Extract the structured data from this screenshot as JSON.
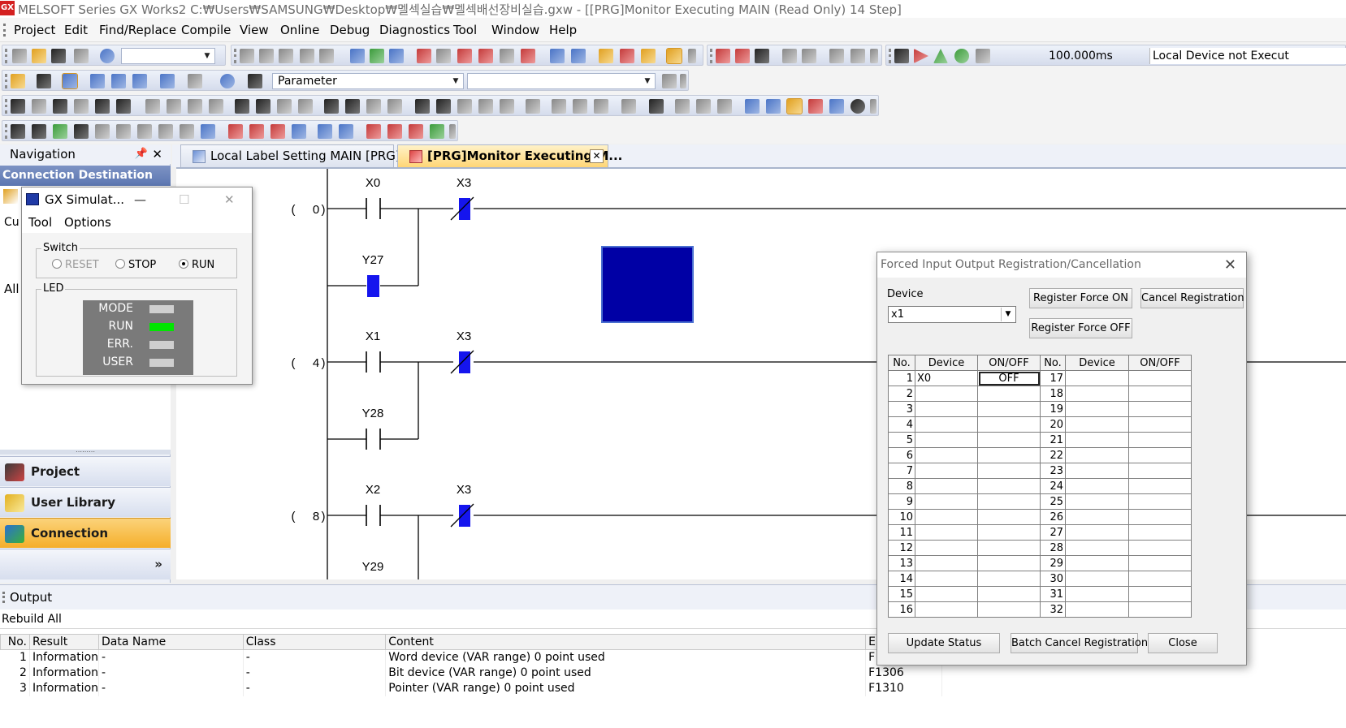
{
  "window": {
    "title": "MELSOFT Series GX Works2 C:₩Users₩SAMSUNG₩Desktop₩멜섹실습₩멜섹배선장비실습.gxw - [[PRG]Monitor Executing MAIN (Read Only) 14 Step]",
    "app_icon_text": "GX"
  },
  "menu": {
    "items": [
      {
        "label": "Project"
      },
      {
        "label": "Edit"
      },
      {
        "label": "Find/Replace"
      },
      {
        "label": "Compile"
      },
      {
        "label": "View"
      },
      {
        "label": "Online"
      },
      {
        "label": "Debug"
      },
      {
        "label": "Diagnostics"
      },
      {
        "label": "Tool"
      },
      {
        "label": "Window"
      },
      {
        "label": "Help"
      }
    ]
  },
  "toolbar": {
    "scan_time": "100.000ms",
    "device_status": "Local Device not Execut",
    "parameter_combo": "Parameter"
  },
  "navigation": {
    "title": "Navigation",
    "pin": "ᵖ",
    "close": "✕",
    "section": "Connection Destination",
    "fragment1": "Cu",
    "fragment2": "All",
    "buttons": [
      {
        "label": "Project"
      },
      {
        "label": "User Library"
      },
      {
        "label": "Connection Destination"
      }
    ],
    "more": "»"
  },
  "tabs": [
    {
      "label": "Local Label Setting MAIN [PRG]"
    },
    {
      "label": "[PRG]Monitor Executing M...",
      "close": "✕"
    }
  ],
  "ladder": {
    "rungs": [
      {
        "step": "0",
        "contact": "X0",
        "branch": "Y27",
        "coil": "X3"
      },
      {
        "step": "4",
        "contact": "X1",
        "branch": "Y28",
        "coil": "X3"
      },
      {
        "step": "8",
        "contact": "X2",
        "branch": "Y29",
        "coil": "X3"
      }
    ],
    "step_open": "(",
    "step_close": ")"
  },
  "simulator": {
    "title": "GX Simulat...",
    "min": "—",
    "max": "☐",
    "close": "✕",
    "menu": [
      "Tool",
      "Options"
    ],
    "switch_label": "Switch",
    "modes": [
      {
        "label": "RESET",
        "selected": false,
        "disabled": true
      },
      {
        "label": "STOP",
        "selected": false,
        "disabled": false
      },
      {
        "label": "RUN",
        "selected": true,
        "disabled": false
      }
    ],
    "led_label": "LED",
    "leds": [
      {
        "name": "MODE",
        "color": "#cfcfcf"
      },
      {
        "name": "RUN",
        "color": "#00e600"
      },
      {
        "name": "ERR.",
        "color": "#cfcfcf"
      },
      {
        "name": "USER",
        "color": "#cfcfcf"
      }
    ]
  },
  "forced_dialog": {
    "title": "Forced Input Output Registration/Cancellation",
    "close": "✕",
    "device_label": "Device",
    "device_value": "x1",
    "buttons": {
      "force_on": "Register Force ON",
      "force_off": "Register Force OFF",
      "cancel_reg": "Cancel Registration",
      "update": "Update Status",
      "batch_cancel": "Batch Cancel Registration",
      "close": "Close"
    },
    "columns": [
      "No.",
      "Device",
      "ON/OFF",
      "No.",
      "Device",
      "ON/OFF"
    ],
    "rows": [
      {
        "no": "1",
        "device": "X0",
        "state": "OFF",
        "no2": "17",
        "device2": "",
        "state2": ""
      },
      {
        "no": "2",
        "device": "",
        "state": "",
        "no2": "18",
        "device2": "",
        "state2": ""
      },
      {
        "no": "3",
        "device": "",
        "state": "",
        "no2": "19",
        "device2": "",
        "state2": ""
      },
      {
        "no": "4",
        "device": "",
        "state": "",
        "no2": "20",
        "device2": "",
        "state2": ""
      },
      {
        "no": "5",
        "device": "",
        "state": "",
        "no2": "21",
        "device2": "",
        "state2": ""
      },
      {
        "no": "6",
        "device": "",
        "state": "",
        "no2": "22",
        "device2": "",
        "state2": ""
      },
      {
        "no": "7",
        "device": "",
        "state": "",
        "no2": "23",
        "device2": "",
        "state2": ""
      },
      {
        "no": "8",
        "device": "",
        "state": "",
        "no2": "24",
        "device2": "",
        "state2": ""
      },
      {
        "no": "9",
        "device": "",
        "state": "",
        "no2": "25",
        "device2": "",
        "state2": ""
      },
      {
        "no": "10",
        "device": "",
        "state": "",
        "no2": "26",
        "device2": "",
        "state2": ""
      },
      {
        "no": "11",
        "device": "",
        "state": "",
        "no2": "27",
        "device2": "",
        "state2": ""
      },
      {
        "no": "12",
        "device": "",
        "state": "",
        "no2": "28",
        "device2": "",
        "state2": ""
      },
      {
        "no": "13",
        "device": "",
        "state": "",
        "no2": "29",
        "device2": "",
        "state2": ""
      },
      {
        "no": "14",
        "device": "",
        "state": "",
        "no2": "30",
        "device2": "",
        "state2": ""
      },
      {
        "no": "15",
        "device": "",
        "state": "",
        "no2": "31",
        "device2": "",
        "state2": ""
      },
      {
        "no": "16",
        "device": "",
        "state": "",
        "no2": "32",
        "device2": "",
        "state2": ""
      }
    ]
  },
  "output": {
    "title": "Output",
    "subtitle": "Rebuild All",
    "columns": [
      "No.",
      "Result",
      "Data Name",
      "Class",
      "Content",
      "Er"
    ],
    "rows": [
      {
        "no": "1",
        "result": "Information",
        "data_name": "-",
        "class": "-",
        "content": "Word device (VAR range) 0 point used",
        "code": "F"
      },
      {
        "no": "2",
        "result": "Information",
        "data_name": "-",
        "class": "-",
        "content": "Bit device (VAR range) 0 point used",
        "code": "F1306"
      },
      {
        "no": "3",
        "result": "Information",
        "data_name": "-",
        "class": "-",
        "content": "Pointer (VAR range) 0 point used",
        "code": "F1310"
      }
    ]
  },
  "colors": {
    "accent_nav": "#5c76b1",
    "active_tab": "#ffd676",
    "monitor_blue": "#0000a5",
    "led_run": "#00e600"
  }
}
